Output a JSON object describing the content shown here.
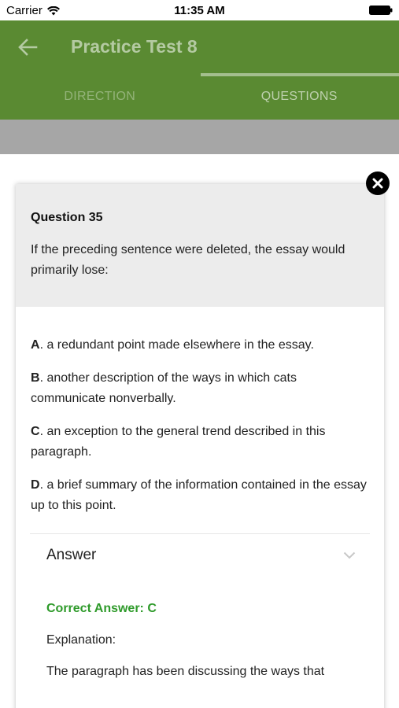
{
  "status_bar": {
    "carrier": "Carrier",
    "time": "11:35 AM",
    "icons": [
      "wifi-icon",
      "battery-icon"
    ]
  },
  "app_bar": {
    "title": "Practice Test 8",
    "back_icon": "back-arrow-icon",
    "tabs": [
      {
        "label": "DIRECTION",
        "active": false
      },
      {
        "label": "QUESTIONS",
        "active": true
      }
    ],
    "color": "#5a8a32"
  },
  "dialog": {
    "close_icon": "close-icon",
    "question_title": "Question 35",
    "question_text": "If the preceding sentence were deleted, the essay would primarily lose:",
    "options": [
      {
        "letter": "A",
        "text": ". a redundant point made elsewhere in the essay."
      },
      {
        "letter": "B",
        "text": ". another description of the ways in which cats communicate nonverbally."
      },
      {
        "letter": "C",
        "text": ". an exception to the general trend described in this paragraph."
      },
      {
        "letter": "D",
        "text": ". a brief summary of the information contained in the essay up to this point."
      }
    ],
    "answer_label": "Answer",
    "answer_toggle_icon": "chevron-down-icon",
    "correct_answer": "Correct Answer: C",
    "explanation_label": "Explanation:",
    "explanation_text": "The paragraph has been discussing the ways that",
    "correct_color": "#2e9a2a"
  }
}
